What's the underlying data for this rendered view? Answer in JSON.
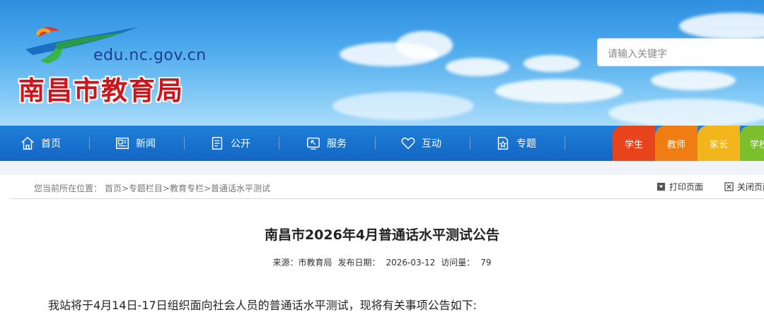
{
  "header": {
    "domain": "edu.nc.gov.cn",
    "site_title": "南昌市教育局",
    "search_placeholder": "请输入关键字"
  },
  "nav": {
    "items": [
      {
        "label": "首页",
        "icon": "home-icon"
      },
      {
        "label": "新闻",
        "icon": "newspaper-icon"
      },
      {
        "label": "公开",
        "icon": "document-list-icon"
      },
      {
        "label": "服务",
        "icon": "service-arrow-icon"
      },
      {
        "label": "互动",
        "icon": "heart-icon"
      },
      {
        "label": "专题",
        "icon": "star-document-icon"
      }
    ],
    "role_tabs": [
      {
        "label": "学生",
        "color": "#e8441c"
      },
      {
        "label": "教师",
        "color": "#f07d14"
      },
      {
        "label": "家长",
        "color": "#f3b51c"
      },
      {
        "label": "学校",
        "color": "#7cbf2c"
      }
    ]
  },
  "breadcrumb": {
    "prefix": "您当前所在位置：",
    "path": "首页>专题栏目>教育专栏>普通话水平测试"
  },
  "tools": {
    "print_label": "打印页面",
    "close_label": "关闭页面"
  },
  "article": {
    "title": "南昌市2026年4月普通话水平测试公告",
    "source_label": "来源：市教育局",
    "date_label": "发布日期：",
    "date": "2026-03-12",
    "views_label": "访问量：",
    "views": "79",
    "intro": "我站将于4月14日-17日组织面向社会人员的普通话水平测试，现将有关事项公告如下:"
  }
}
